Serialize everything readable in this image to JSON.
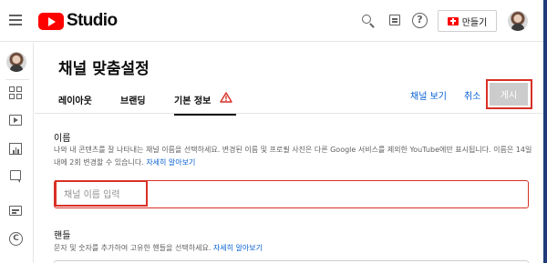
{
  "header": {
    "logo_text": "Studio",
    "create_label": "만들기",
    "icons": [
      "hamburger-menu-icon",
      "youtube-logo-icon",
      "search-icon",
      "feedback-icon",
      "help-icon",
      "create-video-icon",
      "account-avatar"
    ]
  },
  "sidebar": {
    "items": [
      {
        "name": "dashboard",
        "icon": "dashboard-icon"
      },
      {
        "name": "content",
        "icon": "content-play-icon"
      },
      {
        "name": "analytics",
        "icon": "analytics-icon"
      },
      {
        "name": "comments",
        "icon": "comments-icon"
      },
      {
        "name": "subtitles",
        "icon": "subtitles-icon"
      },
      {
        "name": "copyright",
        "icon": "copyright-icon"
      }
    ]
  },
  "page": {
    "title": "채널 맞춤설정",
    "tabs": [
      {
        "label": "레이아웃"
      },
      {
        "label": "브랜딩"
      },
      {
        "label": "기본 정보",
        "active": true,
        "warning": true
      }
    ],
    "actions": {
      "view_channel": "채널 보기",
      "cancel": "취소",
      "publish": "게시"
    }
  },
  "name_field": {
    "label": "이름",
    "description": "나와 내 콘텐츠를 잘 나타내는 채널 이름을 선택하세요. 변경된 이름 및 프로필 사진은 다른 Google 서비스를 제외한 YouTube에만 표시됩니다. 이름은 14일 내에 2회 변경할 수 있습니다.",
    "learn_more": "자세히 알아보기",
    "placeholder": "채널 이름 입력",
    "value": ""
  },
  "handle_field": {
    "label": "핸들",
    "description": "문자 및 숫자를 추가하여 고유한 핸들을 선택하세요.",
    "learn_more": "자세히 알아보기"
  },
  "colors": {
    "accent_red": "#ff0000",
    "link_blue": "#065fd4",
    "error_red": "#d93025",
    "disabled_button": "#cccccc"
  }
}
